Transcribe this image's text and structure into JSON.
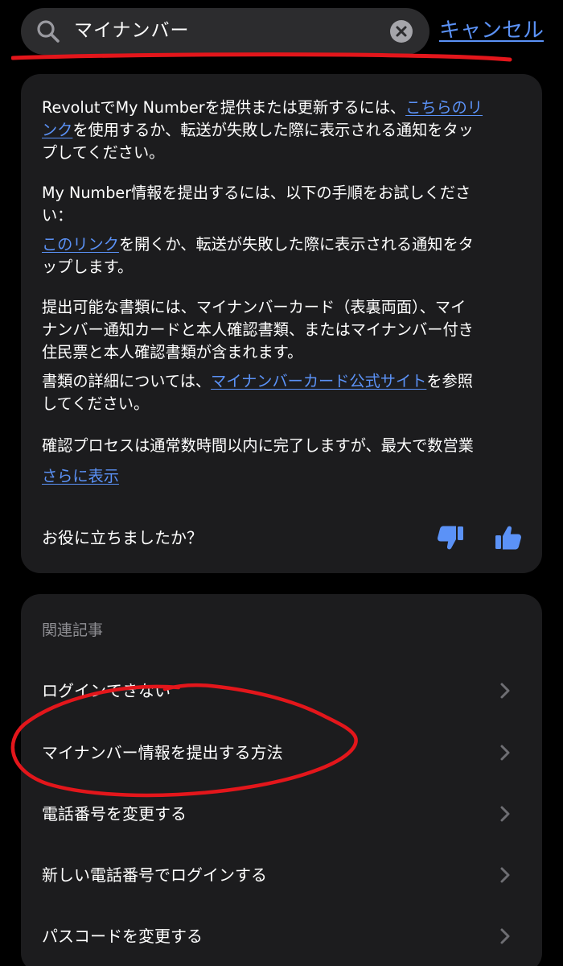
{
  "search": {
    "query": "マイナンバー",
    "cancel_label": "キャンセル"
  },
  "answer": {
    "p1_line1_a": "RevolutでMy Numberを提供または更新するには、",
    "p1_link1_a": "こちらのリ",
    "p1_link1_b": "ンク",
    "p1_line2_rest": "を使用するか、転送が失敗した際に表示される通知をタッ",
    "p1_line3": "プしてください。",
    "p2_line1": "My Number情報を提出するには、以下の手順をお試しくださ",
    "p2_line2": "い：",
    "p3_link": "このリンク",
    "p3_line1_rest": "を開くか、転送が失敗した際に表示される通知をタ",
    "p3_line2": "ップします。",
    "p4_line1": "提出可能な書類には、マイナンバーカード（表裏両面）、マイ",
    "p4_line2": "ナンバー通知カードと本人確認書類、またはマイナンバー付き",
    "p4_line3": "住民票と本人確認書類が含まれます。",
    "p5_line1_a": "書類の詳細については、",
    "p5_link": "マイナンバーカード公式サイト",
    "p5_line1_b": "を参照",
    "p5_line2": "してください。",
    "p6_line1": "確認プロセスは通常数時間以内に完了しますが、最大で数営業",
    "show_more": "さらに表示",
    "helpful_question": "お役に立ちましたか？"
  },
  "related": {
    "heading": "関連記事",
    "items": [
      {
        "label": "ログインできない"
      },
      {
        "label": "マイナンバー情報を提出する方法"
      },
      {
        "label": "電話番号を変更する"
      },
      {
        "label": "新しい電話番号でログインする"
      },
      {
        "label": "パスコードを変更する"
      }
    ]
  },
  "colors": {
    "background": "#000000",
    "card": "#1c1c1e",
    "search_field": "#2c2c2e",
    "link": "#5b92f7",
    "secondary_text": "#8e8e93",
    "annotation": "#e3161b"
  },
  "icons": {
    "search": "search-icon",
    "clear": "clear-icon",
    "thumbs_down": "thumbs-down-icon",
    "thumbs_up": "thumbs-up-icon",
    "chevron": "chevron-right-icon"
  }
}
